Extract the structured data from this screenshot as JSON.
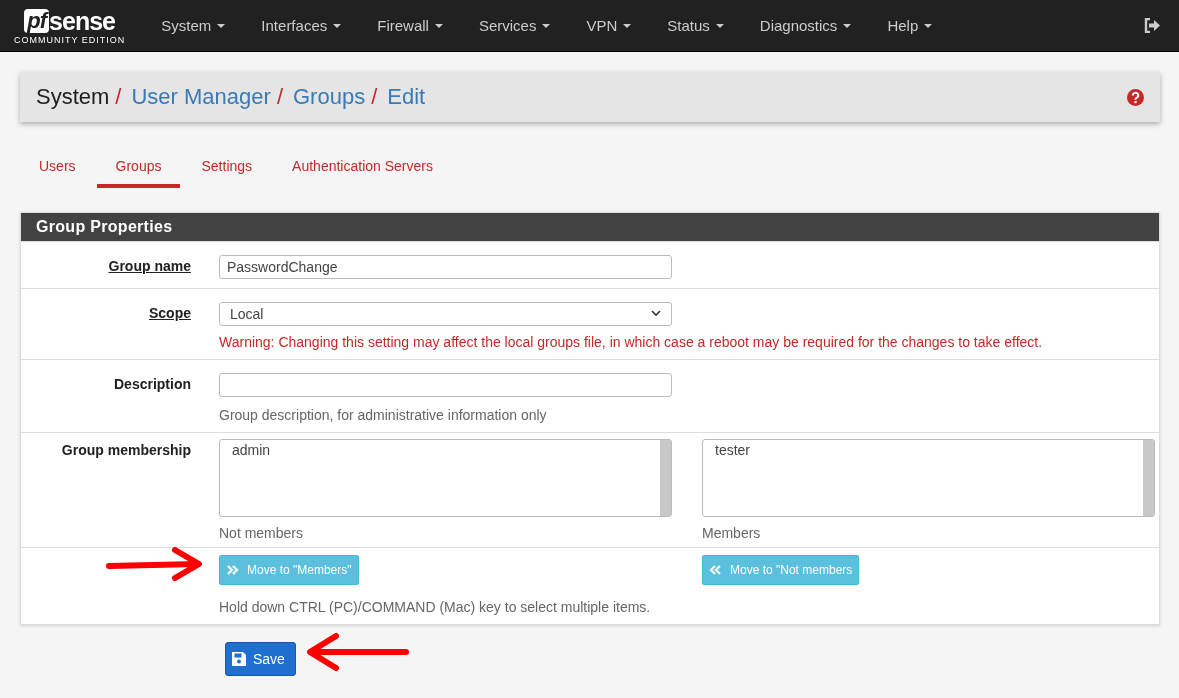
{
  "brand": {
    "mark": "pf",
    "name": "sense",
    "edition": "COMMUNITY EDITION"
  },
  "nav": [
    {
      "label": "System"
    },
    {
      "label": "Interfaces"
    },
    {
      "label": "Firewall"
    },
    {
      "label": "Services"
    },
    {
      "label": "VPN"
    },
    {
      "label": "Status"
    },
    {
      "label": "Diagnostics"
    },
    {
      "label": "Help"
    }
  ],
  "breadcrumb": [
    {
      "label": "System",
      "link": false,
      "separator": "/"
    },
    {
      "label": "User Manager",
      "link": true,
      "separator": "/"
    },
    {
      "label": "Groups",
      "link": true,
      "separator": "/"
    },
    {
      "label": "Edit",
      "link": true
    }
  ],
  "tabs": [
    {
      "label": "Users",
      "selected": false
    },
    {
      "label": "Groups",
      "selected": true
    },
    {
      "label": "Settings",
      "selected": false
    },
    {
      "label": "Authentication Servers",
      "selected": false
    }
  ],
  "panel": {
    "title": "Group Properties",
    "fields": [
      {
        "kind": "text",
        "label": "Group name",
        "underlined": true,
        "value": "PasswordChange"
      },
      {
        "kind": "select",
        "label": "Scope",
        "underlined": true,
        "value": "Local",
        "warning": "Warning: Changing this setting may affect the local groups file, in which case a reboot may be required for the changes to take effect."
      },
      {
        "kind": "text",
        "label": "Description",
        "underlined": false,
        "help": "Group description, for administrative information only"
      }
    ],
    "membership": {
      "label": "Group membership",
      "lists": [
        {
          "items": [
            "admin"
          ],
          "caption": "Not members",
          "button": "Move to \"Members\"",
          "kind": "add"
        },
        {
          "items": [
            "tester"
          ],
          "caption": "Members",
          "button": "Move to \"Not members",
          "kind": "remove"
        }
      ],
      "help": "Hold down CTRL (PC)/COMMAND (Mac) key to select multiple items."
    }
  },
  "save": {
    "label": "Save"
  }
}
